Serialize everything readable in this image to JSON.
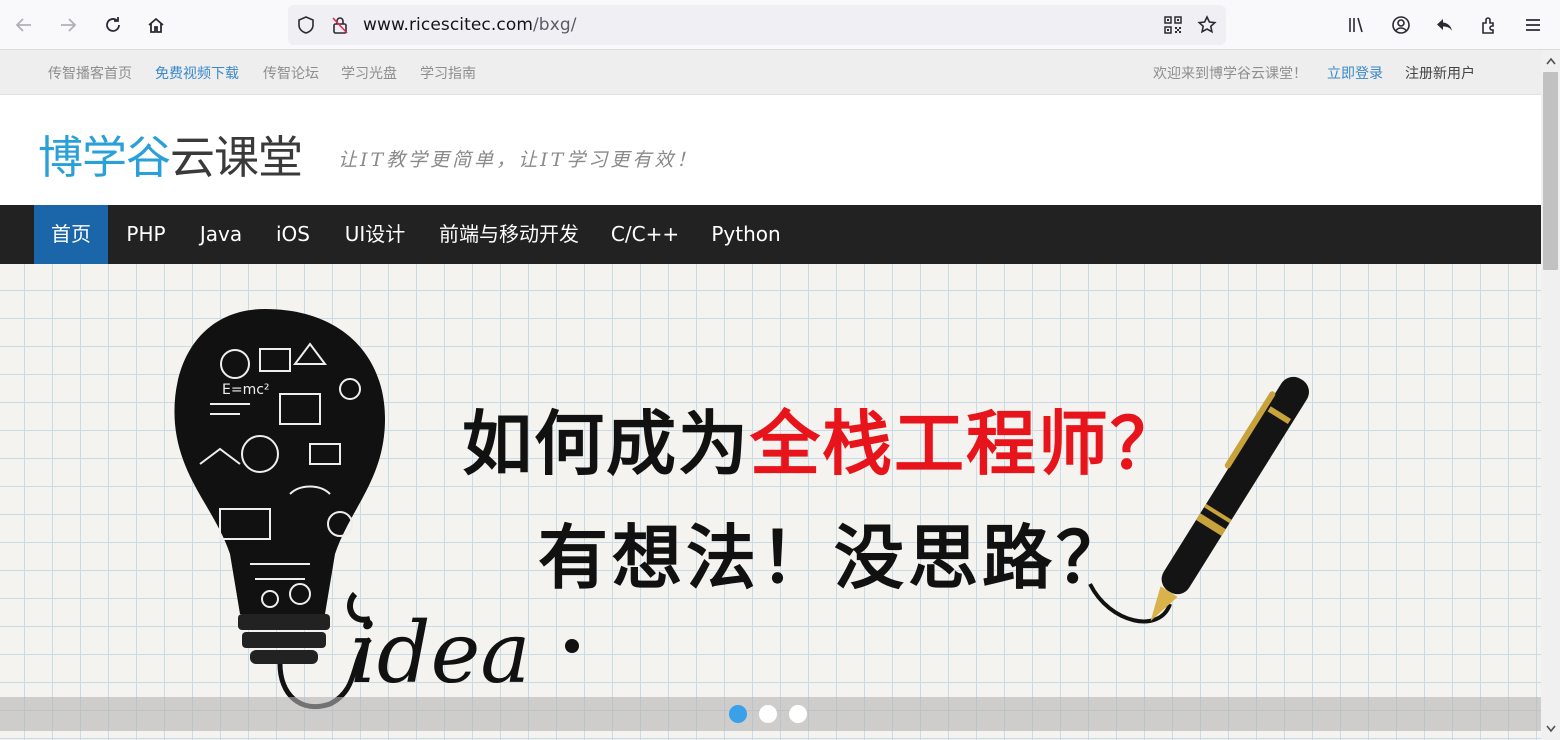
{
  "browser": {
    "url_host": "www.ricescitec.com",
    "url_path": "/bxg/"
  },
  "topbar": {
    "links": [
      "传智播客首页",
      "免费视频下载",
      "传智论坛",
      "学习光盘",
      "学习指南"
    ],
    "welcome": "欢迎来到博学谷云课堂！",
    "login": "立即登录",
    "register": "注册新用户"
  },
  "header": {
    "logo_blue": "博学谷",
    "logo_dark": "云课堂",
    "slogan": "让IT教学更简单，让IT学习更有效！"
  },
  "nav": {
    "items": [
      "首页",
      "PHP",
      "Java",
      "iOS",
      "UI设计",
      "前端与移动开发",
      "C/C++",
      "Python"
    ]
  },
  "banner": {
    "line1_black": "如何成为",
    "line1_red": "全栈工程师？",
    "line2": "有想法！没思路？",
    "idea_text": "idea",
    "active_slide": 1,
    "slide_count": 3
  },
  "colors": {
    "accent_blue": "#1a66a8",
    "logo_blue": "#2aa0d8",
    "banner_red": "#e8141b",
    "nav_bg": "#222222"
  }
}
